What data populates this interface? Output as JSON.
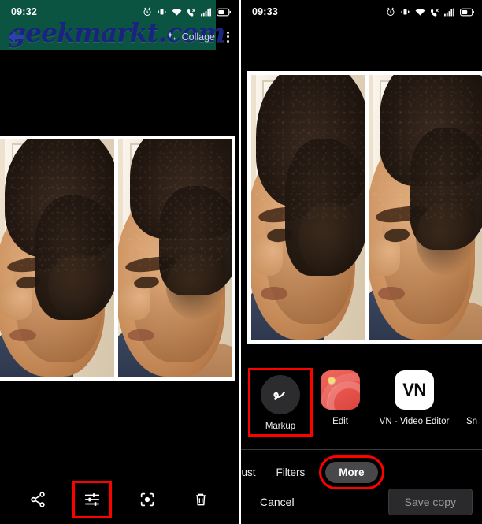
{
  "left_panel": {
    "status_bar": {
      "time": "09:32",
      "icons": [
        "alarm-icon",
        "vibrate-icon",
        "wifi-icon",
        "mute-call-icon",
        "signal-icon",
        "battery-icon"
      ]
    },
    "watermark": {
      "text": "geekmarkt.com",
      "band_color": "#0b5a46",
      "text_color": "#1a237e"
    },
    "app_bar": {
      "back_label": "back-arrow",
      "collage_label": "Collage",
      "overflow_label": "more-options"
    },
    "toolbar": {
      "items": [
        {
          "name": "share",
          "icon": "share-icon",
          "highlighted": false
        },
        {
          "name": "edit",
          "icon": "tune-sliders-icon",
          "highlighted": true
        },
        {
          "name": "lens",
          "icon": "google-lens-icon",
          "highlighted": false
        },
        {
          "name": "delete",
          "icon": "trash-icon",
          "highlighted": false
        }
      ],
      "highlight_color": "#ff0000"
    }
  },
  "right_panel": {
    "status_bar": {
      "time": "09:33",
      "icons": [
        "alarm-icon",
        "vibrate-icon",
        "wifi-icon",
        "mute-call-icon",
        "signal-icon",
        "battery-icon"
      ]
    },
    "share_sheet": {
      "apps": [
        {
          "label": "Markup",
          "icon": "markup-squiggle-icon",
          "highlighted": true
        },
        {
          "label": "Edit",
          "icon": "edit-app-icon",
          "highlighted": false
        },
        {
          "label": "VN - Video Editor",
          "icon": "vn-app-icon",
          "icon_text": "VN",
          "highlighted": false
        },
        {
          "label": "Sn",
          "icon": "cut-off-app-icon",
          "highlighted": false
        }
      ],
      "modes": [
        {
          "label": "djust",
          "style": "text",
          "highlighted": false
        },
        {
          "label": "Filters",
          "style": "text",
          "highlighted": false
        },
        {
          "label": "More",
          "style": "pill",
          "highlighted": true
        }
      ],
      "cancel_label": "Cancel",
      "save_label": "Save copy",
      "highlight_color": "#ff0000"
    }
  },
  "photos": {
    "left_collage_alt": "side-by-side profile photos",
    "right_collage_alt": "side-by-side profile photos"
  }
}
